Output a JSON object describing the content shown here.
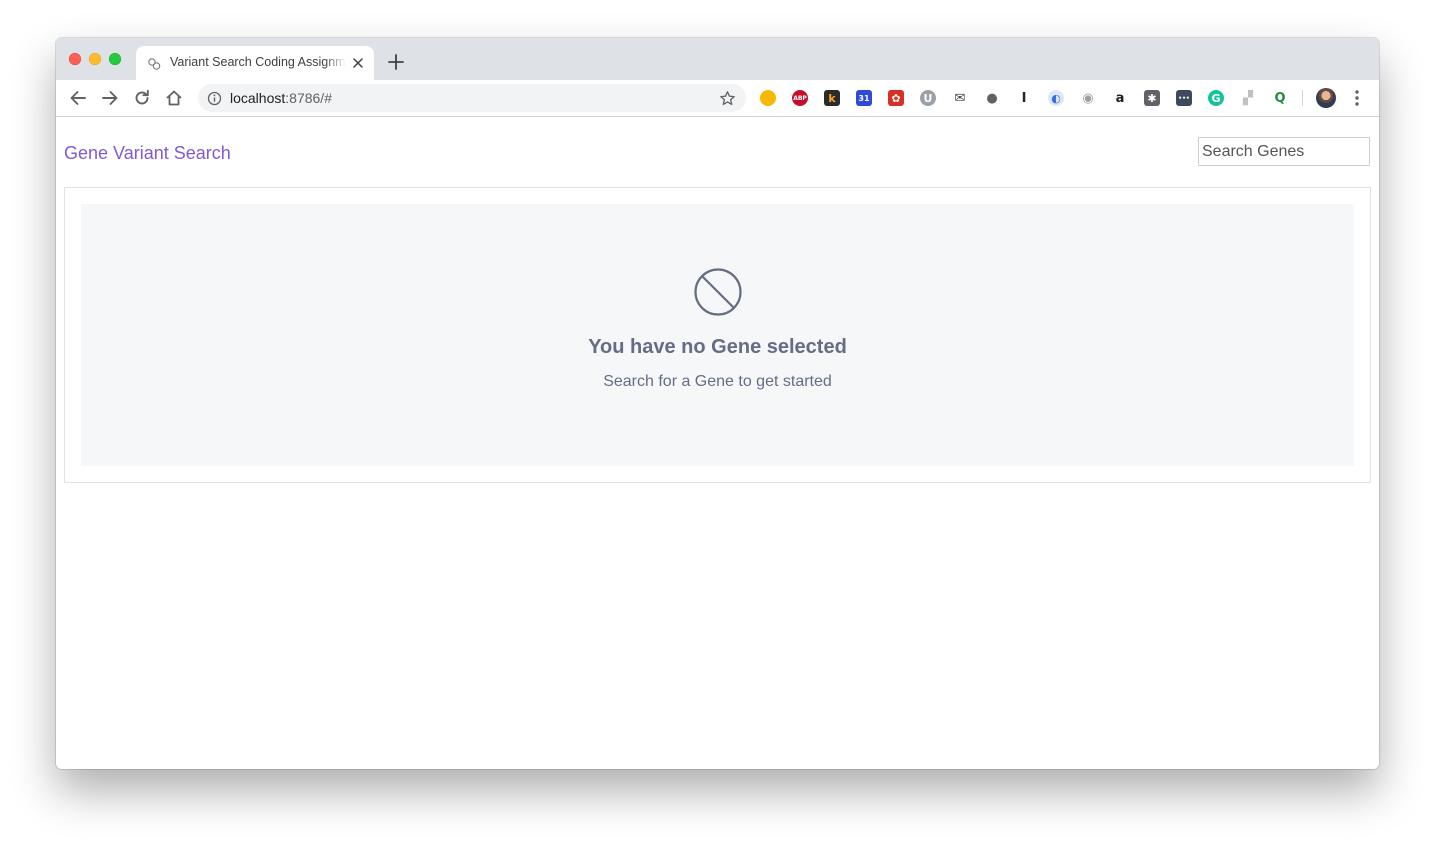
{
  "browser": {
    "tab": {
      "title": "Variant Search Coding Assignment"
    },
    "address_bar": {
      "host": "localhost",
      "path": ":8786/#"
    },
    "extensions": [
      {
        "name": "gold-badge-extension-icon",
        "text": "",
        "bg": "#f6b900",
        "fg": "#ffffff"
      },
      {
        "name": "adblock-plus-icon",
        "text": "ABP",
        "bg": "#c70d2c",
        "fg": "#ffffff"
      },
      {
        "name": "k-extension-icon",
        "text": "k",
        "bg": "#2b2b2b",
        "fg": "#f5a623"
      },
      {
        "name": "calendar-extension-icon",
        "text": "31",
        "bg": "#2d4bd8",
        "fg": "#ffffff"
      },
      {
        "name": "red-gift-extension-icon",
        "text": "✿",
        "bg": "#d93025",
        "fg": "#ffffff"
      },
      {
        "name": "u-extension-icon",
        "text": "U",
        "bg": "#9aa0a6",
        "fg": "#ffffff"
      },
      {
        "name": "mail-check-extension-icon",
        "text": "✉",
        "bg": "#ffffff",
        "fg": "#3c4043"
      },
      {
        "name": "gray-circle-extension-icon",
        "text": "●",
        "bg": "#ffffff",
        "fg": "#5f6368"
      },
      {
        "name": "instapaper-icon",
        "text": "I",
        "bg": "#ffffff",
        "fg": "#202124"
      },
      {
        "name": "blue-swirl-extension-icon",
        "text": "◐",
        "bg": "#dce7f8",
        "fg": "#3b6fd8"
      },
      {
        "name": "camera-extension-icon",
        "text": "◉",
        "bg": "#ffffff",
        "fg": "#9aa0a6"
      },
      {
        "name": "amazon-icon",
        "text": "a",
        "bg": "#ffffff",
        "fg": "#202124"
      },
      {
        "name": "hubspot-icon",
        "text": "✱",
        "bg": "#5f6368",
        "fg": "#ffffff"
      },
      {
        "name": "dots-extension-icon",
        "text": "•••",
        "bg": "#3c4a5c",
        "fg": "#ffffff"
      },
      {
        "name": "grammarly-icon",
        "text": "G",
        "bg": "#15c39a",
        "fg": "#ffffff"
      },
      {
        "name": "gray-square-extension-icon",
        "text": "▞",
        "bg": "#ffffff",
        "fg": "#bdc1c6"
      },
      {
        "name": "green-search-extension-icon",
        "text": "Q",
        "bg": "#ffffff",
        "fg": "#1e8e3e"
      }
    ]
  },
  "app": {
    "brand": "Gene Variant Search",
    "search": {
      "placeholder": "Search Genes",
      "value": ""
    },
    "empty_state": {
      "icon": "no-entry-icon",
      "title": "You have no Gene selected",
      "subtitle": "Search for a Gene to get started"
    }
  },
  "colors": {
    "brand": "#805ad5",
    "empty_text": "#656d85",
    "empty_bg": "#f6f7f9"
  }
}
